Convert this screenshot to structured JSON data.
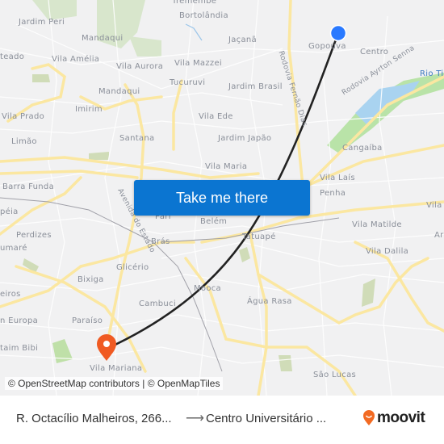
{
  "map": {
    "places": [
      {
        "name": "Tremembé",
        "id": "tremembe"
      },
      {
        "name": "Bortolândia",
        "id": "bortolandia"
      },
      {
        "name": "Jardim Peri",
        "id": "jardim-peri"
      },
      {
        "name": "Mandaqui",
        "id": "mandaqui-north"
      },
      {
        "name": "Jaçanã",
        "id": "jacana"
      },
      {
        "name": "Gopoúva",
        "id": "gopouva"
      },
      {
        "name": "Centro",
        "id": "centro"
      },
      {
        "name": "teado",
        "id": "teado"
      },
      {
        "name": "Vila Amélia",
        "id": "vila-amelia"
      },
      {
        "name": "Vila Aurora",
        "id": "vila-aurora"
      },
      {
        "name": "Vila Mazzei",
        "id": "vila-mazzei"
      },
      {
        "name": "Tucuruvi",
        "id": "tucuruvi"
      },
      {
        "name": "Jardim Brasil",
        "id": "jardim-brasil"
      },
      {
        "name": "Mandaqui",
        "id": "mandaqui-south"
      },
      {
        "name": "Imirim",
        "id": "imirim"
      },
      {
        "name": "Vila Prado",
        "id": "vila-prado"
      },
      {
        "name": "Vila Ede",
        "id": "vila-ede"
      },
      {
        "name": "Limão",
        "id": "limao"
      },
      {
        "name": "Santana",
        "id": "santana"
      },
      {
        "name": "Jardim Japão",
        "id": "jardim-japao"
      },
      {
        "name": "Cangaíba",
        "id": "cangaiba"
      },
      {
        "name": "Vila Maria",
        "id": "vila-maria"
      },
      {
        "name": "Barra Funda",
        "id": "barra-funda"
      },
      {
        "name": "Vila Laís",
        "id": "vila-lais"
      },
      {
        "name": "Penha",
        "id": "penha"
      },
      {
        "name": "péia",
        "id": "peia"
      },
      {
        "name": "Pari",
        "id": "pari"
      },
      {
        "name": "Belém",
        "id": "belem"
      },
      {
        "name": "Vila",
        "id": "vila-east"
      },
      {
        "name": "Vila Matilde",
        "id": "vila-matilde"
      },
      {
        "name": "Perdizes",
        "id": "perdizes"
      },
      {
        "name": "Tatuapé",
        "id": "tatuape"
      },
      {
        "name": "umaré",
        "id": "sumare"
      },
      {
        "name": "Brás",
        "id": "bras"
      },
      {
        "name": "Ar",
        "id": "ar"
      },
      {
        "name": "Vila Dalila",
        "id": "vila-dalila"
      },
      {
        "name": "Glicério",
        "id": "glicerio"
      },
      {
        "name": "Bixiga",
        "id": "bixiga"
      },
      {
        "name": "Mooca",
        "id": "mooca"
      },
      {
        "name": "eiros",
        "id": "eiros"
      },
      {
        "name": "Cambuci",
        "id": "cambuci"
      },
      {
        "name": "Água Rasa",
        "id": "agua-rasa"
      },
      {
        "name": "n Europa",
        "id": "europa"
      },
      {
        "name": "Paraíso",
        "id": "paraiso"
      },
      {
        "name": "taim Bibi",
        "id": "itaim-bibi"
      },
      {
        "name": "Vila Mariana",
        "id": "vila-mariana"
      },
      {
        "name": "São Lucas",
        "id": "sao-lucas"
      },
      {
        "name": "Rio Tietê",
        "id": "rio-tiete"
      },
      {
        "name": "Rodovia Ayrton Senna",
        "id": "rod-ayrton-senna"
      },
      {
        "name": "Rodovia Fernão Dias",
        "id": "rod-fernao-dias"
      },
      {
        "name": "Avenida do Estado",
        "id": "av-do-estado"
      }
    ],
    "origin_marker": {
      "color": "#2979ff"
    },
    "destination_marker": {
      "color": "#f05a22"
    },
    "route_color": "#222222"
  },
  "attribution": "© OpenStreetMap contributors | © OpenMapTiles",
  "cta_label": "Take me there",
  "footer": {
    "from": "R. Octacílio Malheiros, 266...",
    "arrow": "⟶",
    "to": "Centro Universitário ...",
    "brand": "moovit",
    "brand_color": "#f26a22"
  }
}
